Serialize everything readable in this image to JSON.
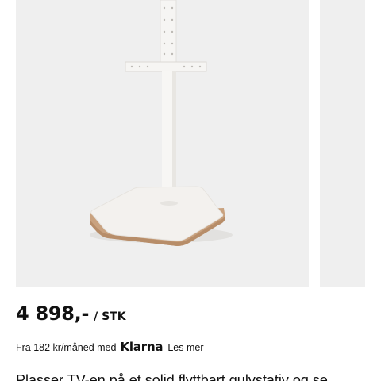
{
  "gallery": {
    "main_image_alt": "TV stand product photo",
    "colors": {
      "background": "#efefef",
      "stand": "#f1efec",
      "base_edge": "#c9a27f"
    }
  },
  "product": {
    "price": "4 898,-",
    "unit": "/ STK",
    "financing_text": "Fra 182 kr/måned med",
    "financing_brand": "Klarna",
    "read_more": "Les mer",
    "description_partial": "Plasser TV-en på et solid flyttbart gulvstativ og se"
  }
}
